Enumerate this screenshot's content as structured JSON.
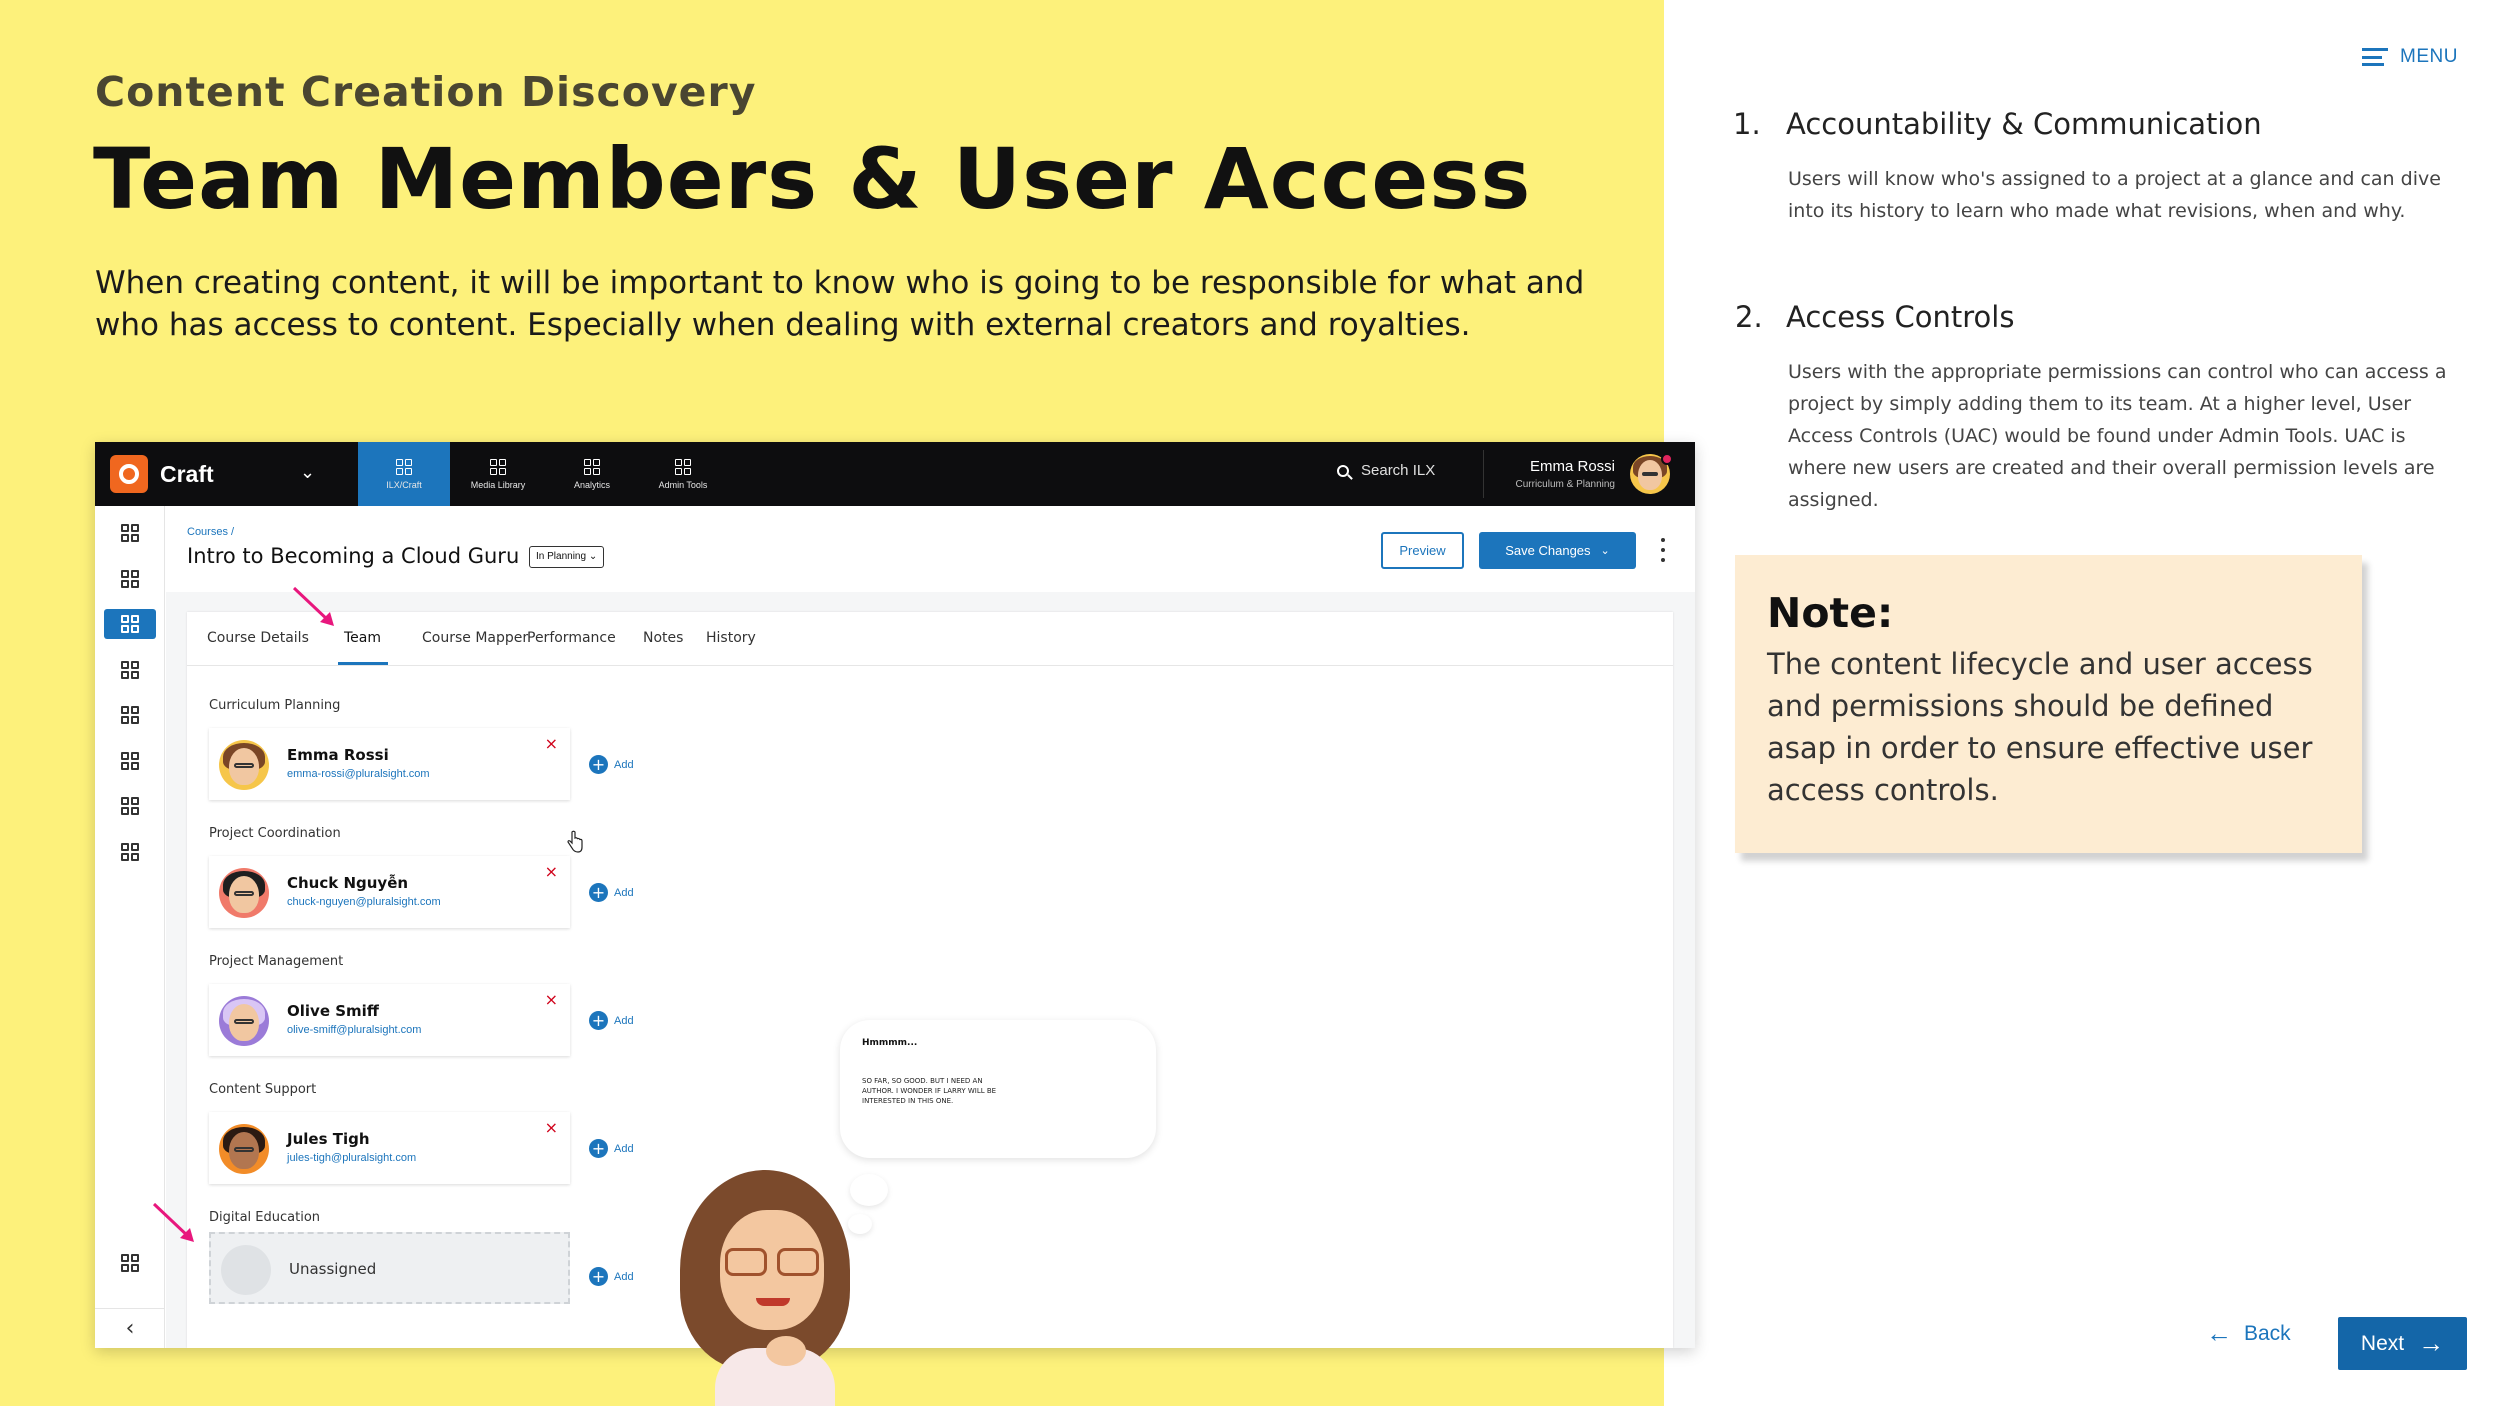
{
  "slide": {
    "eyebrow": "Content Creation Discovery",
    "title": "Team Members & User Access",
    "intro": "When creating content, it will be important to know who is going to be responsible for what and who has access to content. Especially when dealing with external creators and royalties."
  },
  "app": {
    "brand": "Craft",
    "nav": [
      {
        "label": "ILX/Craft"
      },
      {
        "label": "Media Library"
      },
      {
        "label": "Analytics"
      },
      {
        "label": "Admin Tools"
      }
    ],
    "search_label": "Search ILX",
    "user": {
      "name": "Emma Rossi",
      "role": "Curriculum & Planning"
    },
    "breadcrumb": "Courses /",
    "course_title": "Intro to Becoming a Cloud Guru",
    "status": "In Planning",
    "preview_label": "Preview",
    "save_label": "Save Changes",
    "tabs": [
      "Course Details",
      "Team",
      "Course Mapper",
      "Performance",
      "Notes",
      "History"
    ],
    "add_label": "Add",
    "sections": [
      {
        "label": "Curriculum Planning",
        "name": "Emma Rossi",
        "email": "emma-rossi@pluralsight.com"
      },
      {
        "label": "Project Coordination",
        "name": "Chuck Nguyễn",
        "email": "chuck-nguyen@pluralsight.com"
      },
      {
        "label": "Project Management",
        "name": "Olive Smiff",
        "email": "olive-smiff@pluralsight.com"
      },
      {
        "label": "Content Support",
        "name": "Jules Tigh",
        "email": "jules-tigh@pluralsight.com"
      },
      {
        "label": "Digital Education",
        "name": "Unassigned",
        "email": ""
      }
    ],
    "remove_glyph": "×",
    "add_glyph": "+"
  },
  "bubble": {
    "title": "Hmmmm...",
    "text": "So far, so good. But I need an Author. I wonder if Larry will be interested in this one."
  },
  "menu_label": "MENU",
  "points": [
    {
      "num": "1.",
      "title": "Accountability & Communication",
      "body": "Users will know who's assigned to a project at a glance and can dive into its history to learn who made what revisions, when and why."
    },
    {
      "num": "2.",
      "title": "Access Controls",
      "body": "Users with the appropriate permissions can control who can access a project by simply adding them to its team. At a higher level, User Access Controls (UAC) would be found under Admin Tools. UAC is where new users are created and their overall permission levels are assigned."
    }
  ],
  "note": {
    "title": "Note:",
    "body": "The content lifecycle and user access and permissions should be defined asap in order to ensure effective user access controls."
  },
  "footer": {
    "back_label": "Back",
    "next_label": "Next"
  },
  "colors": {
    "panel_yellow": "#fdf17b",
    "accent_blue": "#1c75bc",
    "brand_orange": "#f0671f",
    "note_bg": "#fdecd2",
    "arrow_pink": "#e8177d"
  }
}
